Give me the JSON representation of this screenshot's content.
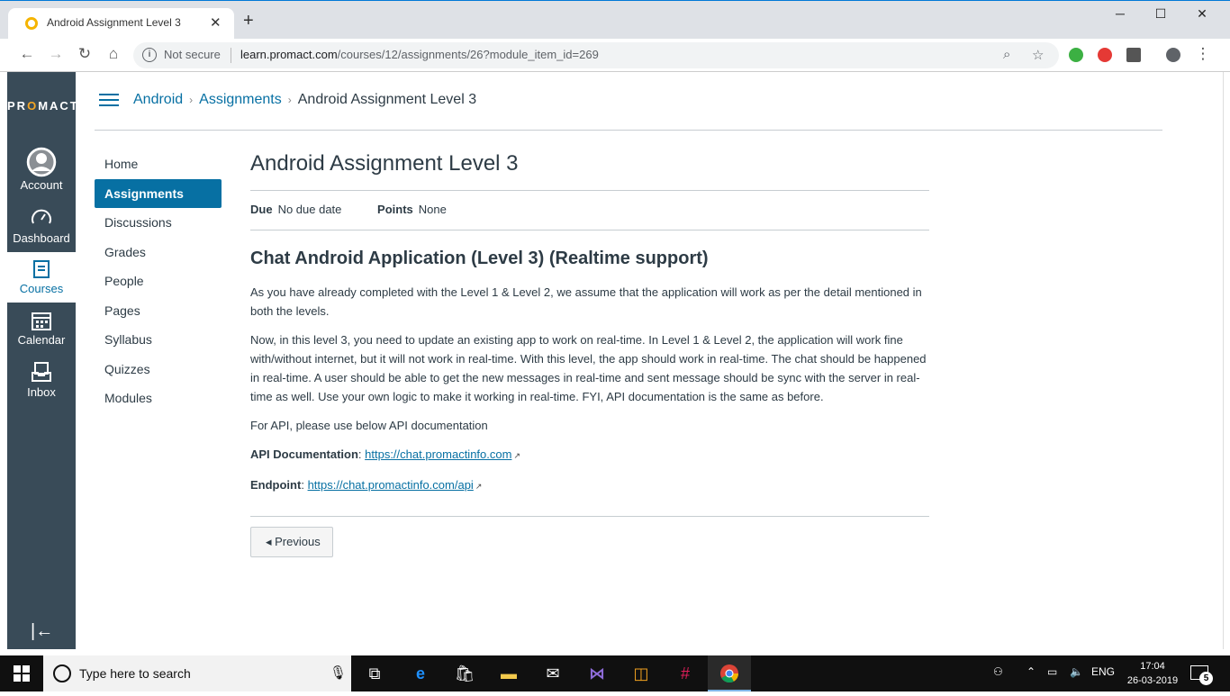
{
  "browser": {
    "tab_title": "Android Assignment Level 3",
    "tab_close": "✕",
    "new_tab": "+",
    "security_label": "Not secure",
    "url_host": "learn.promact.com",
    "url_path": "/courses/12/assignments/26?module_item_id=269",
    "window_controls": {
      "minimize": "─",
      "maximize": "☐",
      "close": "✕"
    }
  },
  "global_nav": {
    "logo_prefix": "PR",
    "logo_o": "O",
    "logo_suffix": "MACT",
    "items": [
      {
        "label": "Account",
        "icon": "avatar-icon"
      },
      {
        "label": "Dashboard",
        "icon": "dashboard-icon"
      },
      {
        "label": "Courses",
        "icon": "courses-icon",
        "active": true
      },
      {
        "label": "Calendar",
        "icon": "calendar-icon"
      },
      {
        "label": "Inbox",
        "icon": "inbox-icon"
      }
    ],
    "collapse_glyph": "|←"
  },
  "breadcrumb": {
    "course": "Android",
    "section": "Assignments",
    "current": "Android Assignment Level 3",
    "separator": "›"
  },
  "course_nav": [
    {
      "label": "Home"
    },
    {
      "label": "Assignments",
      "active": true
    },
    {
      "label": "Discussions"
    },
    {
      "label": "Grades"
    },
    {
      "label": "People"
    },
    {
      "label": "Pages"
    },
    {
      "label": "Syllabus"
    },
    {
      "label": "Quizzes"
    },
    {
      "label": "Modules"
    }
  ],
  "assignment": {
    "title": "Android Assignment Level 3",
    "due_label": "Due",
    "due_value": "No due date",
    "points_label": "Points",
    "points_value": "None",
    "heading": "Chat Android Application (Level 3) (Realtime support)",
    "paragraph1": "As you have already completed with the Level 1 & Level 2, we assume that the application will work as per the detail mentioned in both the levels.",
    "paragraph2": "Now, in this level 3, you need to update an existing app to work on real-time. In Level 1 & Level 2, the application will work fine with/without internet, but it will not work in real-time. With this level, the app should work in real-time. The chat should be happened in real-time. A user should be able to get the new messages in real-time and sent message should be sync with the server in real-time as well. Use your own logic to make it working in real-time. FYI, API documentation is the same as before.",
    "paragraph3": "For API, please use below API documentation",
    "api_doc_label": "API Documentation",
    "api_doc_url": "https://chat.promactinfo.com",
    "endpoint_label": "Endpoint",
    "endpoint_url": "https://chat.promactinfo.com/api",
    "previous_button": "◂ Previous"
  },
  "taskbar": {
    "search_placeholder": "Type here to search",
    "language": "ENG",
    "time": "17:04",
    "date": "26-03-2019",
    "notification_count": "5"
  },
  "colors": {
    "accent": "#0770a3",
    "global_nav_bg": "#394b58",
    "logo_accent": "#f5a623"
  }
}
